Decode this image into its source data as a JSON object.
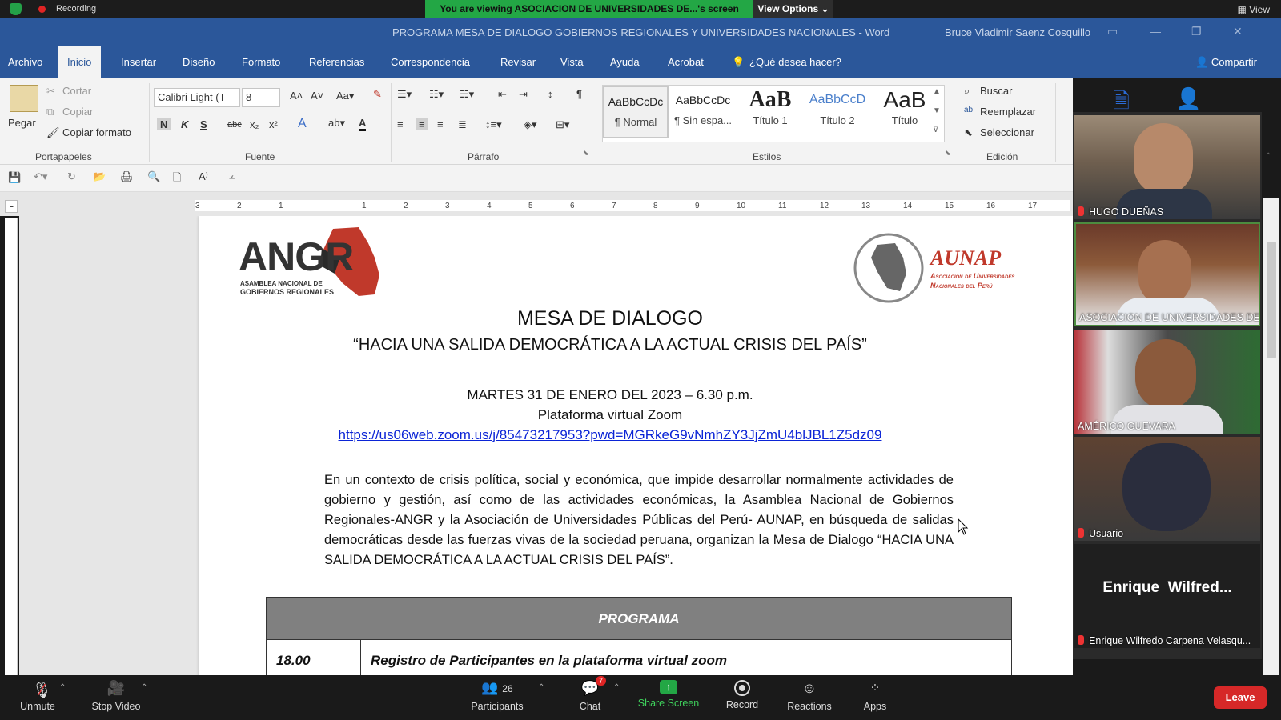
{
  "zoom_top": {
    "recording": "Recording",
    "banner": "You are viewing ASOCIACION DE UNIVERSIDADES DE...'s screen",
    "view_options": "View Options",
    "view": "View"
  },
  "word": {
    "title": "PROGRAMA MESA DE DIALOGO GOBIERNOS REGIONALES Y UNIVERSIDADES NACIONALES  -  Word",
    "user": "Bruce Vladimir Saenz Cosquillo",
    "tabs": [
      "Archivo",
      "Inicio",
      "Insertar",
      "Diseño",
      "Formato",
      "Referencias",
      "Correspondencia",
      "Revisar",
      "Vista",
      "Ayuda",
      "Acrobat",
      "¿Qué desea hacer?"
    ],
    "share": "Compartir",
    "ribbon": {
      "paste": "Pegar",
      "cut": "Cortar",
      "copy": "Copiar",
      "copy_format": "Copiar formato",
      "clipboard_label": "Portapapeles",
      "font_name": "Calibri Light (T",
      "font_size": "8",
      "font_label": "Fuente",
      "paragraph_label": "Párrafo",
      "styles_label": "Estilos",
      "edit_label": "Edición",
      "styles": [
        {
          "sample": "AaBbCcDc",
          "name": "¶ Normal"
        },
        {
          "sample": "AaBbCcDc",
          "name": "¶ Sin espa..."
        },
        {
          "sample": "AaB",
          "name": "Título 1"
        },
        {
          "sample": "AaBbCcD",
          "name": "Título 2"
        },
        {
          "sample": "AaB",
          "name": "Título"
        }
      ],
      "find": "Buscar",
      "replace": "Reemplazar",
      "select": "Seleccionar"
    }
  },
  "document": {
    "logo_left": "ANGR",
    "logo_left_sub1": "ASAMBLEA NACIONAL DE",
    "logo_left_sub2": "GOBIERNOS REGIONALES",
    "logo_right": "AUNAP",
    "logo_right_sub1": "Asociación de Universidades",
    "logo_right_sub2": "Nacionales del Perú",
    "heading": "MESA DE DIALOGO",
    "subheading": "“HACIA UNA SALIDA DEMOCRÁTICA A LA ACTUAL CRISIS DEL PAÍS”",
    "date": "MARTES 31 DE ENERO DEL 2023 – 6.30 p.m.",
    "platform": "Plataforma virtual Zoom",
    "link": "https://us06web.zoom.us/j/85473217953?pwd=MGRkeG9vNmhZY3JjZmU4blJBL1Z5dz09",
    "paragraph": "En un contexto de crisis política, social y económica, que impide desarrollar normalmente actividades de gobierno y gestión, así como de las actividades económicas, la Asamblea Nacional de Gobiernos Regionales-ANGR y la Asociación de Universidades Públicas del Perú- AUNAP, en búsqueda de salidas democráticas desde las fuerzas vivas de la sociedad peruana, organizan la Mesa de Dialogo “HACIA UNA SALIDA DEMOCRÁTICA A LA ACTUAL CRISIS DEL PAÍS”.",
    "table_header": "PROGRAMA",
    "row1_time": "18.00",
    "row1_text": "Registro de Participantes en la plataforma virtual zoom"
  },
  "participants": [
    {
      "name": "HUGO DUEÑAS",
      "muted": true
    },
    {
      "name": "ASOCIACION DE UNIVERSIDADES DE...",
      "muted": false
    },
    {
      "name": "AMÉRICO GUEVARA",
      "muted": false
    },
    {
      "name": "Usuario",
      "muted": true
    },
    {
      "name": "Enrique Wilfredo Carpena Velasqu...",
      "muted": true,
      "big_name": "Enrique  Wilfred..."
    }
  ],
  "zoom_bottom": {
    "unmute": "Unmute",
    "stop_video": "Stop Video",
    "participants": "Participants",
    "participants_count": "26",
    "chat": "Chat",
    "chat_badge": "7",
    "share_screen": "Share Screen",
    "record": "Record",
    "reactions": "Reactions",
    "apps": "Apps",
    "leave": "Leave"
  },
  "colors": {
    "word_blue": "#2b579a",
    "zoom_green": "#23a745",
    "leave_red": "#d62828",
    "link_blue": "#0b24d6"
  }
}
